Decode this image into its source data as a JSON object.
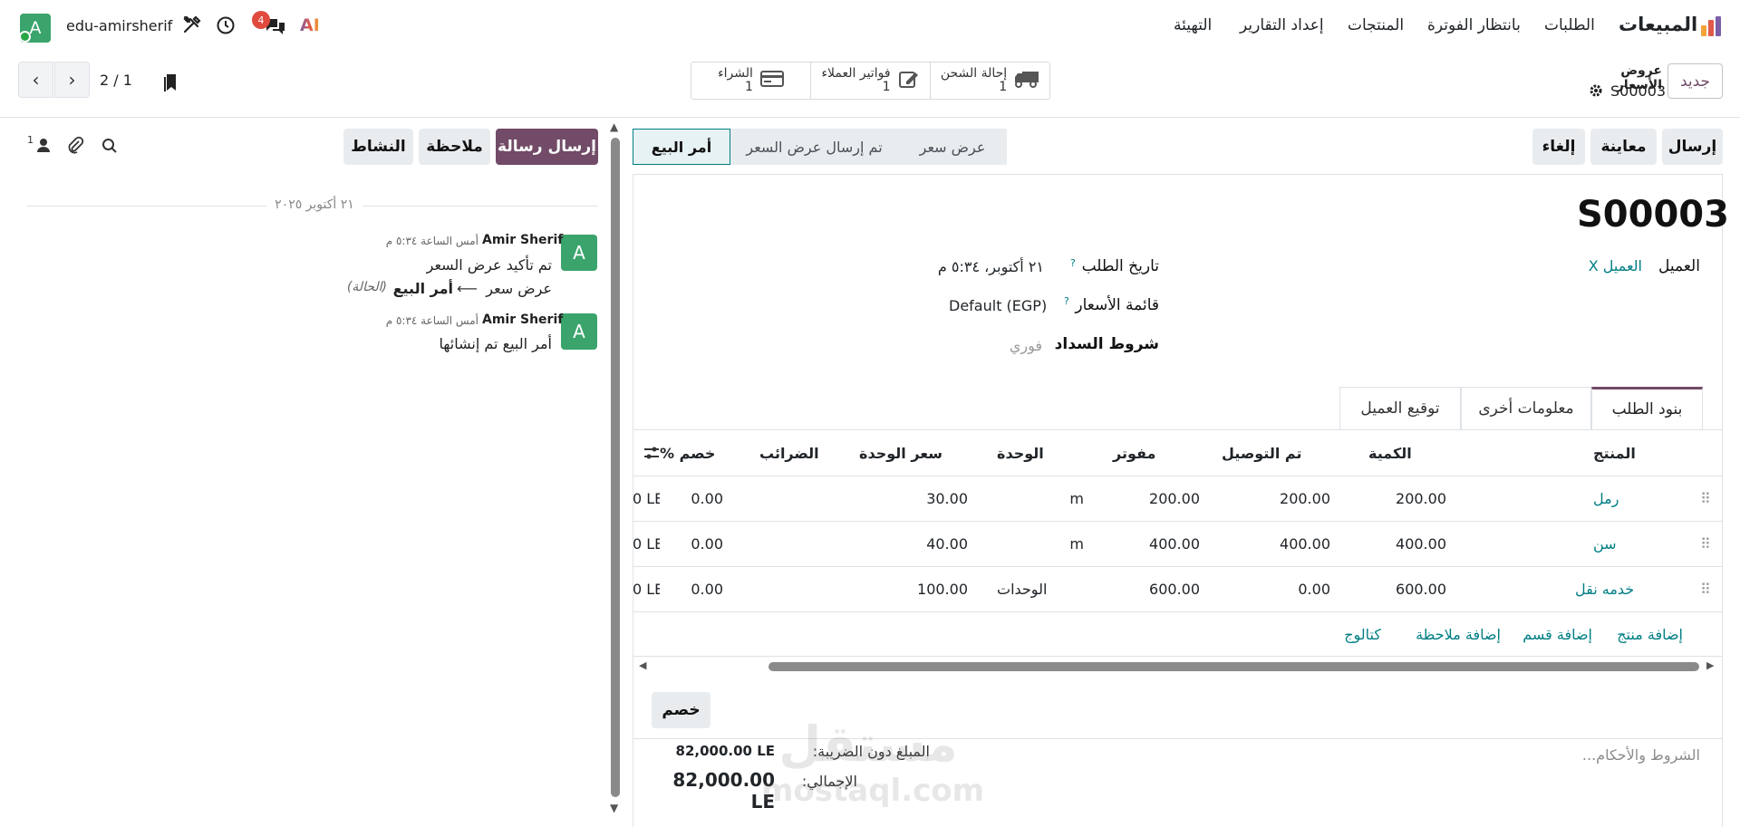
{
  "nav": {
    "brand": "المبيعات",
    "menu": [
      "الطلبات",
      "بانتظار الفوترة",
      "المنتجات",
      "إعداد التقارير",
      "التهيئة"
    ],
    "user": "edu-amirsherif",
    "avatar_letter": "A",
    "notification_count": "4",
    "ai_label": "AI"
  },
  "control": {
    "new_label": "جديد",
    "breadcrumb_parent": "عروض الأسعار",
    "breadcrumb_current": "S00003",
    "pager": "2 / 1",
    "smart_buttons": [
      {
        "label": "إحالة الشحن",
        "count": "1",
        "icon": "truck-icon"
      },
      {
        "label": "فواتير العملاء",
        "count": "1",
        "icon": "edit-icon"
      },
      {
        "label": "الشراء",
        "count": "1",
        "icon": "credit-card-icon"
      }
    ]
  },
  "actions": {
    "send": "إرسال",
    "preview": "معاينة",
    "cancel": "إلغاء"
  },
  "status": {
    "stages": [
      "عرض سعر",
      "تم إرسال عرض السعر",
      "أمر البيع"
    ],
    "active": "أمر البيع"
  },
  "form": {
    "name": "S00003",
    "customer_label": "العميل",
    "customer_value": "العميل X",
    "order_date_label": "تاريخ الطلب",
    "order_date_value": "٢١ أكتوبر، ٥:٣٤ م",
    "pricelist_label": "قائمة الأسعار",
    "pricelist_value": "Default (EGP)",
    "payment_terms_label": "شروط السداد",
    "payment_terms_value": "فوري",
    "help_mark": "?"
  },
  "tabs": [
    "بنود الطلب",
    "معلومات أخرى",
    "توقيع العميل"
  ],
  "lines": {
    "headers": {
      "product": "المنتج",
      "qty": "الكمية",
      "delivered": "تم التوصيل",
      "invoiced": "مفوتر",
      "uom": "الوحدة",
      "price": "سعر الوحدة",
      "taxes": "الضرائب",
      "discount": "خصم %"
    },
    "rows": [
      {
        "product": "رمل",
        "qty": "200.00",
        "delivered": "200.00",
        "invoiced": "200.00",
        "uom": "m",
        "price": "30.00",
        "taxes": "",
        "discount": "0.00",
        "subtotal": "0 LE"
      },
      {
        "product": "سن",
        "qty": "400.00",
        "delivered": "400.00",
        "invoiced": "400.00",
        "uom": "m",
        "price": "40.00",
        "taxes": "",
        "discount": "0.00",
        "subtotal": "0 LE"
      },
      {
        "product": "خدمه نقل",
        "qty": "600.00",
        "delivered": "0.00",
        "invoiced": "600.00",
        "uom": "الوحدات",
        "price": "100.00",
        "taxes": "",
        "discount": "0.00",
        "subtotal": "0 LE"
      }
    ],
    "add_product": "إضافة منتج",
    "add_section": "إضافة قسم",
    "add_note": "إضافة ملاحظة",
    "catalog": "كتالوج"
  },
  "footer": {
    "discount_button": "خصم",
    "terms_placeholder": "الشروط والأحكام...",
    "untaxed_label": "المبلغ دون الضريبة:",
    "untaxed_value": "82,000.00 LE",
    "total_label": "الإجمالي:",
    "total_value": "82,000.00 LE"
  },
  "chatter": {
    "send_message": "إرسال رسالة",
    "log_note": "ملاحظة",
    "activity": "النشاط",
    "followers_count": "1",
    "date_separator": "٢١ أكتوبر ٢٠٢٥",
    "messages": [
      {
        "author": "Amir Sherif",
        "time": "أمس الساعة ٥:٣٤ م",
        "body": "تم تأكيد عرض السعر",
        "change_from": "عرض سعر",
        "change_to": "أمر البيع",
        "change_field": "(الحالة)"
      },
      {
        "author": "Amir Sherif",
        "time": "أمس الساعة ٥:٣٤ م",
        "body": "أمر البيع تم إنشائها"
      }
    ]
  },
  "watermark": {
    "line1": "مستقل",
    "line2": "mostaql.com"
  },
  "colors": {
    "brand": "#714b67",
    "link": "#017e84",
    "avatar": "#3aa46c",
    "badge": "#e04a3f"
  }
}
